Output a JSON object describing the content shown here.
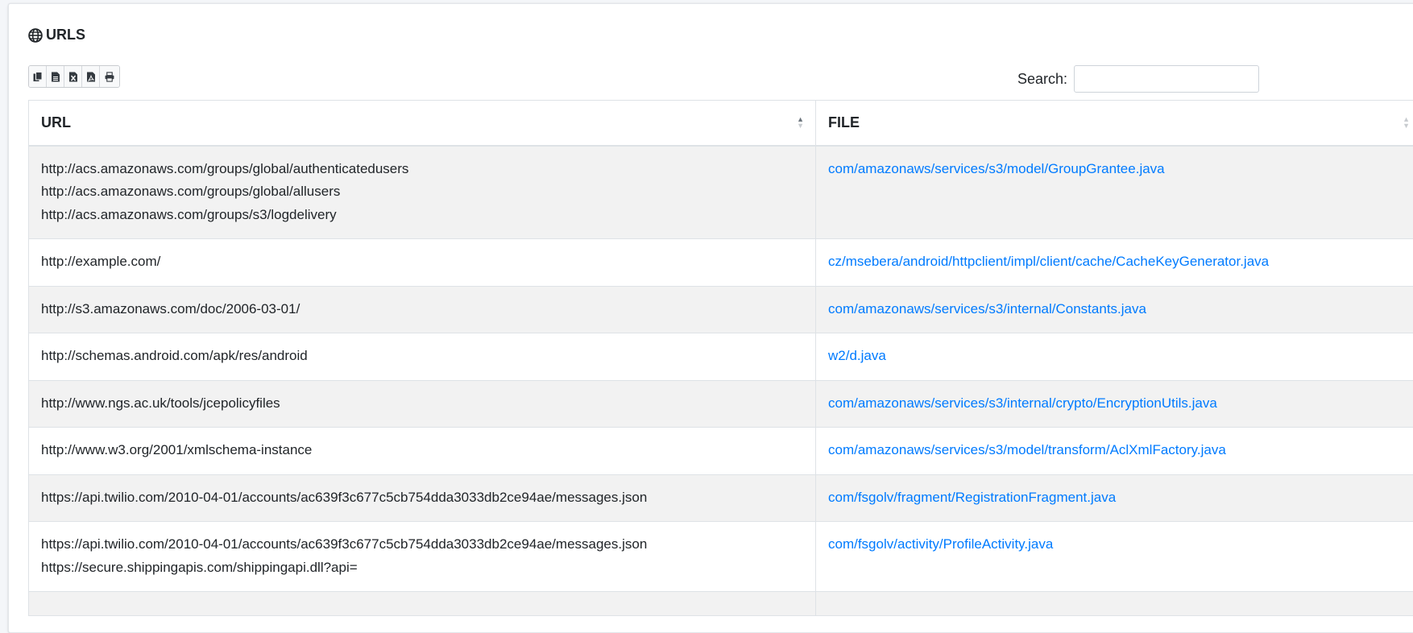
{
  "section": {
    "title": "URLS",
    "icon": "globe-icon"
  },
  "toolbar": {
    "buttons": [
      {
        "name": "copy-button",
        "icon": "copy-icon"
      },
      {
        "name": "csv-button",
        "icon": "csv-file-icon"
      },
      {
        "name": "excel-button",
        "icon": "excel-file-icon"
      },
      {
        "name": "pdf-button",
        "icon": "pdf-file-icon"
      },
      {
        "name": "print-button",
        "icon": "print-icon"
      }
    ]
  },
  "search": {
    "label": "Search:",
    "value": ""
  },
  "table": {
    "columns": [
      "URL",
      "FILE"
    ],
    "rows": [
      {
        "urls": [
          "http://acs.amazonaws.com/groups/global/authenticatedusers",
          "http://acs.amazonaws.com/groups/global/allusers",
          "http://acs.amazonaws.com/groups/s3/logdelivery"
        ],
        "file": "com/amazonaws/services/s3/model/GroupGrantee.java"
      },
      {
        "urls": [
          "http://example.com/"
        ],
        "file": "cz/msebera/android/httpclient/impl/client/cache/CacheKeyGenerator.java"
      },
      {
        "urls": [
          "http://s3.amazonaws.com/doc/2006-03-01/"
        ],
        "file": "com/amazonaws/services/s3/internal/Constants.java"
      },
      {
        "urls": [
          "http://schemas.android.com/apk/res/android"
        ],
        "file": "w2/d.java"
      },
      {
        "urls": [
          "http://www.ngs.ac.uk/tools/jcepolicyfiles"
        ],
        "file": "com/amazonaws/services/s3/internal/crypto/EncryptionUtils.java"
      },
      {
        "urls": [
          "http://www.w3.org/2001/xmlschema-instance"
        ],
        "file": "com/amazonaws/services/s3/model/transform/AclXmlFactory.java"
      },
      {
        "urls": [
          "https://api.twilio.com/2010-04-01/accounts/ac639f3c677c5cb754dda3033db2ce94ae/messages.json"
        ],
        "file": "com/fsgolv/fragment/RegistrationFragment.java"
      },
      {
        "urls": [
          "https://api.twilio.com/2010-04-01/accounts/ac639f3c677c5cb754dda3033db2ce94ae/messages.json",
          "https://secure.shippingapis.com/shippingapi.dll?api="
        ],
        "file": "com/fsgolv/activity/ProfileActivity.java"
      },
      {
        "urls": [
          ""
        ],
        "file": ""
      }
    ]
  },
  "colors": {
    "link": "#007bff",
    "stripe": "#f2f2f2",
    "border": "#dee2e6"
  }
}
